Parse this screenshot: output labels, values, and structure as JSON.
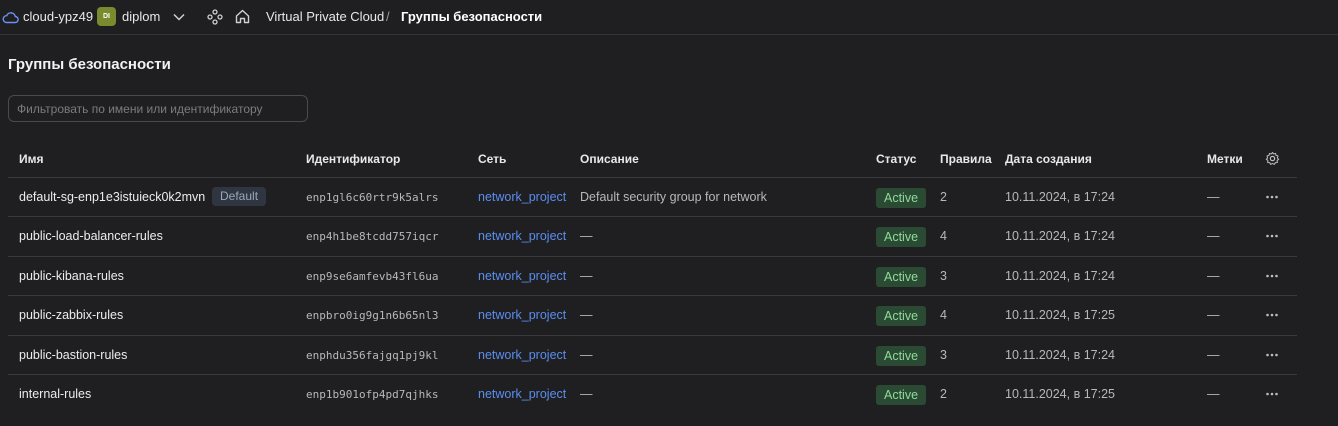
{
  "topbar": {
    "cloud_label": "cloud-ypz49",
    "folder_badge": "DI",
    "folder_label": "diplom",
    "breadcrumb_service": "Virtual Private Cloud",
    "breadcrumb_separator": "/",
    "breadcrumb_current": "Группы безопасности"
  },
  "page": {
    "title": "Группы безопасности",
    "filter_placeholder": "Фильтровать по имени или идентификатору",
    "filter_value": ""
  },
  "table": {
    "headers": {
      "name": "Имя",
      "id": "Идентификатор",
      "network": "Сеть",
      "description": "Описание",
      "status": "Статус",
      "rules": "Правила",
      "created": "Дата создания",
      "labels": "Метки"
    },
    "rows": [
      {
        "name": "default-sg-enp1e3istuieck0k2mvn",
        "badge": "Default",
        "id": "enp1gl6c60rtr9k5alrs",
        "network": "network_project",
        "description": "Default security group for network",
        "status": "Active",
        "rules": "2",
        "created": "10.11.2024, в 17:24",
        "labels": "—"
      },
      {
        "name": "public-load-balancer-rules",
        "badge": "",
        "id": "enp4h1be8tcdd757iqcr",
        "network": "network_project",
        "description": "—",
        "status": "Active",
        "rules": "4",
        "created": "10.11.2024, в 17:24",
        "labels": "—"
      },
      {
        "name": "public-kibana-rules",
        "badge": "",
        "id": "enp9se6amfevb43fl6ua",
        "network": "network_project",
        "description": "—",
        "status": "Active",
        "rules": "3",
        "created": "10.11.2024, в 17:24",
        "labels": "—"
      },
      {
        "name": "public-zabbix-rules",
        "badge": "",
        "id": "enpbro0ig9g1n6b65nl3",
        "network": "network_project",
        "description": "—",
        "status": "Active",
        "rules": "4",
        "created": "10.11.2024, в 17:25",
        "labels": "—"
      },
      {
        "name": "public-bastion-rules",
        "badge": "",
        "id": "enphdu356fajgq1pj9kl",
        "network": "network_project",
        "description": "—",
        "status": "Active",
        "rules": "3",
        "created": "10.11.2024, в 17:24",
        "labels": "—"
      },
      {
        "name": "internal-rules",
        "badge": "",
        "id": "enp1b901ofp4pd7qjhks",
        "network": "network_project",
        "description": "—",
        "status": "Active",
        "rules": "2",
        "created": "10.11.2024, в 17:25",
        "labels": "—"
      }
    ]
  },
  "icons": {
    "cloud": "cloud-icon",
    "chevron": "chevron-down-icon",
    "services": "services-icon",
    "home": "home-icon",
    "settings": "gear-icon",
    "row_actions": "more-horizontal-icon"
  },
  "colors": {
    "background": "#1f1f21",
    "link": "#5b8def",
    "status_active_bg": "#2b4a33",
    "status_active_text": "#8fdb9a",
    "folder_badge": "#7a8a2e"
  }
}
